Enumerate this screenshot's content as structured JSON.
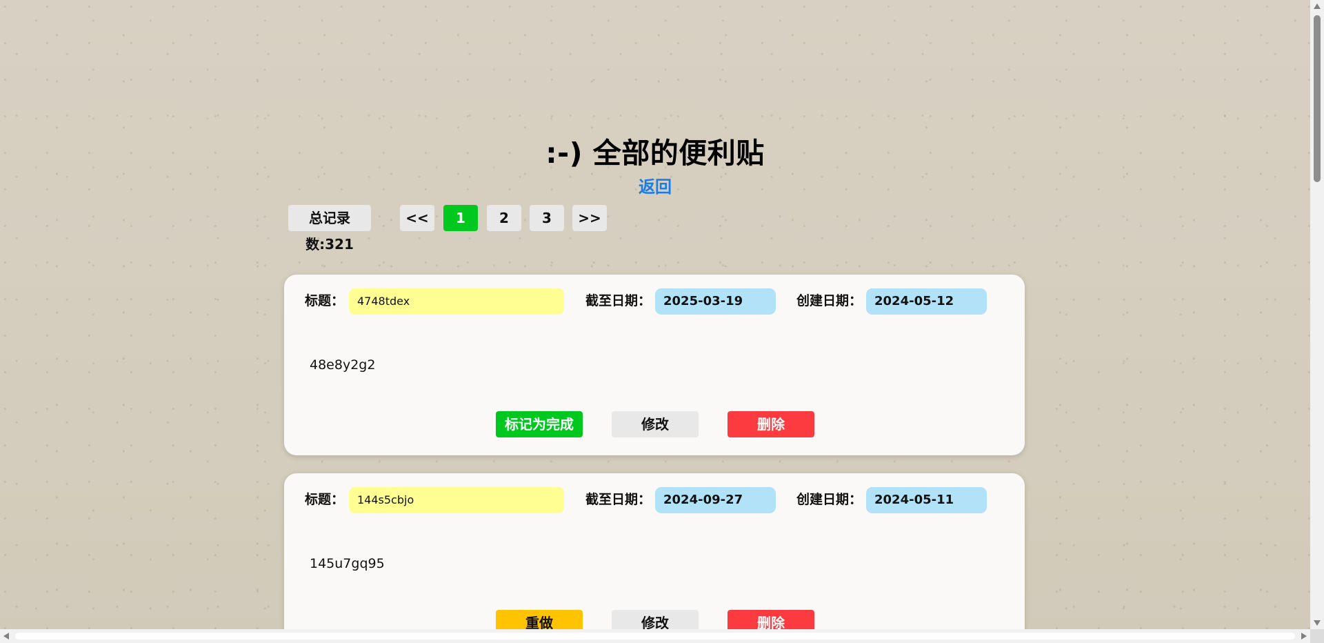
{
  "header": {
    "title": ":-) 全部的便利贴",
    "back_label": "返回"
  },
  "pagination": {
    "total_label": "总记录数:321",
    "prev_label": "<<",
    "pages": [
      "1",
      "2",
      "3"
    ],
    "current_page": "1",
    "next_label": ">>"
  },
  "notes": [
    {
      "title_label": "标题：",
      "title": "4748tdex",
      "due_label": "截至日期：",
      "due_date": "2025-03-19",
      "created_label": "创建日期：",
      "created_date": "2024-05-12",
      "content": "48e8y2g2",
      "primary_action": "标记为完成",
      "edit_label": "修改",
      "delete_label": "删除"
    },
    {
      "title_label": "标题：",
      "title": "144s5cbjo",
      "due_label": "截至日期：",
      "due_date": "2024-09-27",
      "created_label": "创建日期：",
      "created_date": "2024-05-11",
      "content": "145u7gq95",
      "primary_action": "重做",
      "edit_label": "修改",
      "delete_label": "删除"
    }
  ],
  "colors": {
    "accent_green": "#00c81e",
    "redo_yellow": "#ffc300",
    "delete_red": "#fb3b3f",
    "link_blue": "#1a7de6",
    "title_field": "#fffe93",
    "date_field": "#b2e2f7"
  }
}
